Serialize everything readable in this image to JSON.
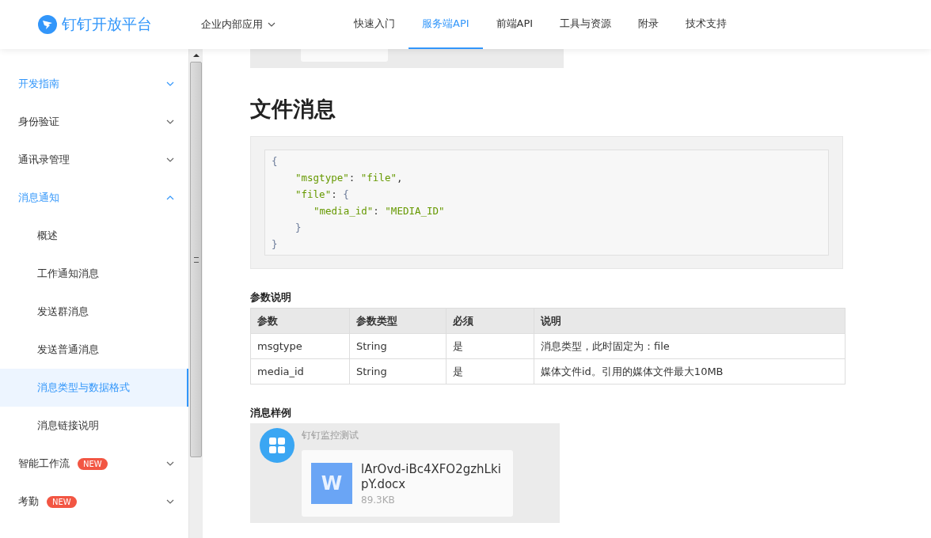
{
  "header": {
    "logo_text": "钉钉开放平台",
    "app_menu": "企业内部应用",
    "nav": [
      {
        "label": "快速入门",
        "selected": false
      },
      {
        "label": "服务端API",
        "selected": true
      },
      {
        "label": "前端API",
        "selected": false
      },
      {
        "label": "工具与资源",
        "selected": false
      },
      {
        "label": "附录",
        "selected": false
      },
      {
        "label": "技术支持",
        "selected": false
      }
    ]
  },
  "sidebar": {
    "items": [
      {
        "label": "开发指南",
        "highlighted": true,
        "expanded": false
      },
      {
        "label": "身份验证",
        "highlighted": false,
        "expanded": false
      },
      {
        "label": "通讯录管理",
        "highlighted": false,
        "expanded": false
      },
      {
        "label": "消息通知",
        "highlighted": true,
        "expanded": true,
        "children": [
          {
            "label": "概述",
            "selected": false
          },
          {
            "label": "工作通知消息",
            "selected": false
          },
          {
            "label": "发送群消息",
            "selected": false
          },
          {
            "label": "发送普通消息",
            "selected": false
          },
          {
            "label": "消息类型与数据格式",
            "selected": true
          },
          {
            "label": "消息链接说明",
            "selected": false
          }
        ]
      },
      {
        "label": "智能工作流",
        "highlighted": false,
        "expanded": false,
        "badge": "NEW"
      },
      {
        "label": "考勤",
        "highlighted": false,
        "expanded": false,
        "badge": "NEW"
      }
    ]
  },
  "content": {
    "heading": "文件消息",
    "code_lines": [
      {
        "kind": "outer",
        "tokens": [
          {
            "kind": "punct",
            "text": "{"
          }
        ]
      },
      {
        "kind": "inner",
        "tokens": [
          {
            "kind": "string",
            "text": "\"msgtype\""
          },
          {
            "kind": "plain",
            "text": ": "
          },
          {
            "kind": "string",
            "text": "\"file\""
          },
          {
            "kind": "plain",
            "text": ","
          }
        ]
      },
      {
        "kind": "inner",
        "tokens": [
          {
            "kind": "string",
            "text": "\"file\""
          },
          {
            "kind": "plain",
            "text": ": "
          },
          {
            "kind": "punct",
            "text": "{"
          }
        ]
      },
      {
        "kind": "deep",
        "tokens": [
          {
            "kind": "string",
            "text": "\"media_id\""
          },
          {
            "kind": "plain",
            "text": ": "
          },
          {
            "kind": "string",
            "text": "\"MEDIA_ID\""
          }
        ]
      },
      {
        "kind": "inner",
        "tokens": [
          {
            "kind": "punct",
            "text": "}"
          }
        ]
      },
      {
        "kind": "outer",
        "tokens": [
          {
            "kind": "punct",
            "text": "}"
          }
        ]
      }
    ],
    "params_title": "参数说明",
    "table": {
      "columns": [
        "参数",
        "参数类型",
        "必须",
        "说明"
      ],
      "rows": [
        [
          "msgtype",
          "String",
          "是",
          "消息类型，此时固定为：file"
        ],
        [
          "media_id",
          "String",
          "是",
          "媒体文件id。引用的媒体文件最大10MB"
        ]
      ]
    },
    "example_title": "消息样例",
    "example": {
      "sender": "钉钉监控测试",
      "file_letter": "W",
      "file_name": "lArOvd-iBc4XFO2gzhLkipY.docx",
      "file_size": "89.3KB"
    }
  }
}
